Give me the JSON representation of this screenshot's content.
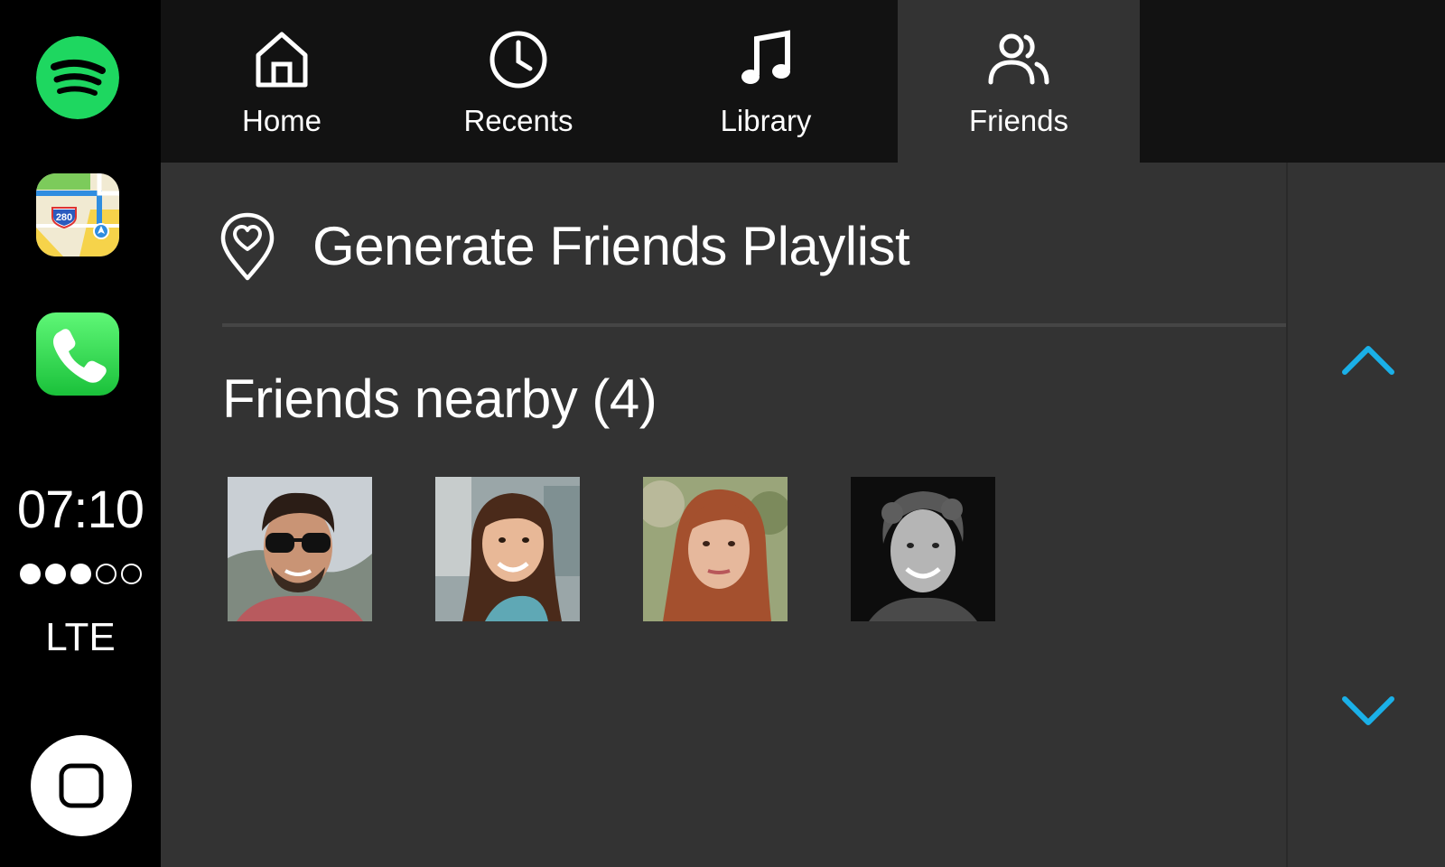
{
  "dock": {
    "apps": [
      {
        "name": "Spotify",
        "icon": "spotify-icon",
        "color": "#1ed760"
      },
      {
        "name": "Maps",
        "icon": "maps-icon",
        "badge_text": "280"
      },
      {
        "name": "Phone",
        "icon": "phone-icon",
        "color": "#2bd14d"
      }
    ],
    "time": "07:10",
    "signal_strength": {
      "filled": 3,
      "total": 5
    },
    "network": "LTE",
    "home_button_icon": "home-square-icon"
  },
  "tabs": [
    {
      "label": "Home",
      "icon": "home-icon",
      "active": false
    },
    {
      "label": "Recents",
      "icon": "clock-icon",
      "active": false
    },
    {
      "label": "Library",
      "icon": "music-note-icon",
      "active": false
    },
    {
      "label": "Friends",
      "icon": "friends-icon",
      "active": true
    }
  ],
  "content": {
    "generate_playlist": {
      "label": "Generate Friends Playlist",
      "icon": "heart-pin-icon"
    },
    "friends_nearby": {
      "title": "Friends nearby (4)",
      "friends": [
        {
          "avatar": "friend-avatar-1"
        },
        {
          "avatar": "friend-avatar-2"
        },
        {
          "avatar": "friend-avatar-3"
        },
        {
          "avatar": "friend-avatar-4"
        }
      ]
    }
  },
  "scroll": {
    "up_icon": "chevron-up-icon",
    "down_icon": "chevron-down-icon",
    "accent": "#1ab0e8"
  },
  "colors": {
    "tabbar_bg": "#121212",
    "content_bg": "#333333",
    "dock_bg": "#000000"
  }
}
